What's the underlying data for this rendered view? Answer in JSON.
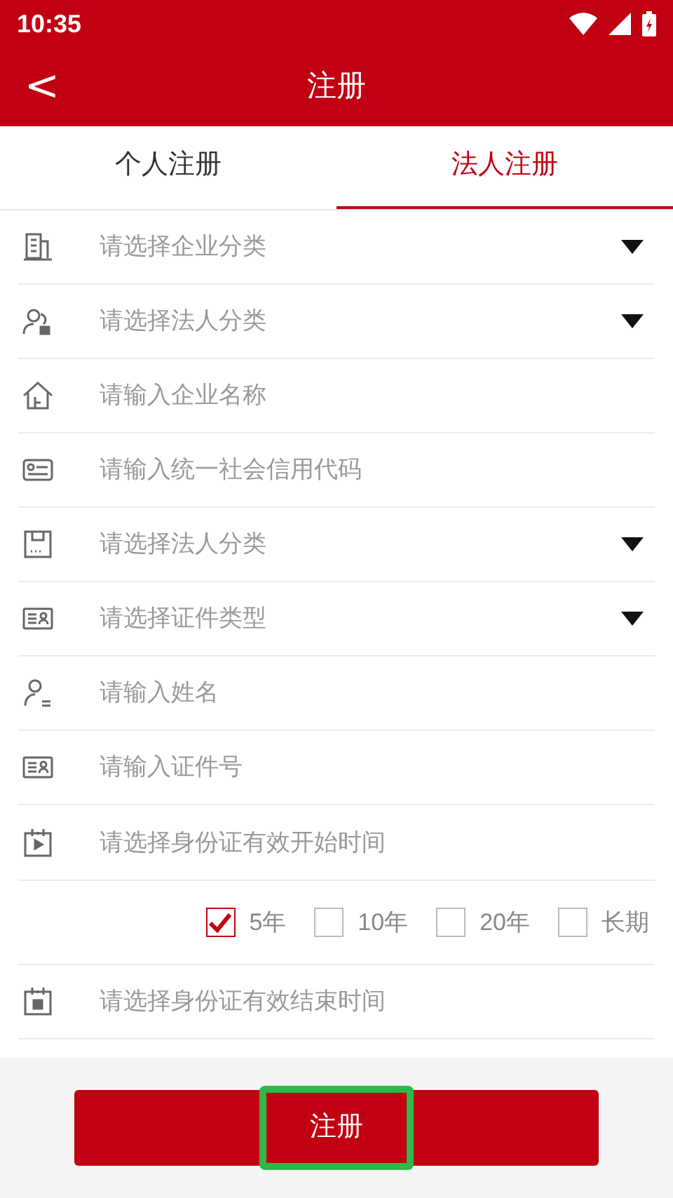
{
  "status_bar": {
    "time": "10:35"
  },
  "header": {
    "title": "注册",
    "back": "<"
  },
  "tabs": [
    {
      "label": "个人注册",
      "selected": false
    },
    {
      "label": "法人注册",
      "selected": true
    }
  ],
  "fields": [
    {
      "kind": "select",
      "placeholder": "请选择企业分类"
    },
    {
      "kind": "select",
      "placeholder": "请选择法人分类"
    },
    {
      "kind": "input",
      "placeholder": "请输入企业名称"
    },
    {
      "kind": "input",
      "placeholder": "请输入统一社会信用代码"
    },
    {
      "kind": "select",
      "placeholder": "请选择法人分类"
    },
    {
      "kind": "select",
      "placeholder": "请选择证件类型"
    },
    {
      "kind": "input",
      "placeholder": "请输入姓名"
    },
    {
      "kind": "input",
      "placeholder": "请输入证件号"
    },
    {
      "kind": "picker",
      "placeholder": "请选择身份证有效开始时间"
    },
    {
      "kind": "validity",
      "options": [
        {
          "label": "5年",
          "selected": true
        },
        {
          "label": "10年",
          "selected": false
        },
        {
          "label": "20年",
          "selected": false
        },
        {
          "label": "长期",
          "selected": false
        }
      ]
    },
    {
      "kind": "picker",
      "placeholder": "请选择身份证有效结束时间"
    }
  ],
  "submit": {
    "label": "注册",
    "highlighted": true
  }
}
